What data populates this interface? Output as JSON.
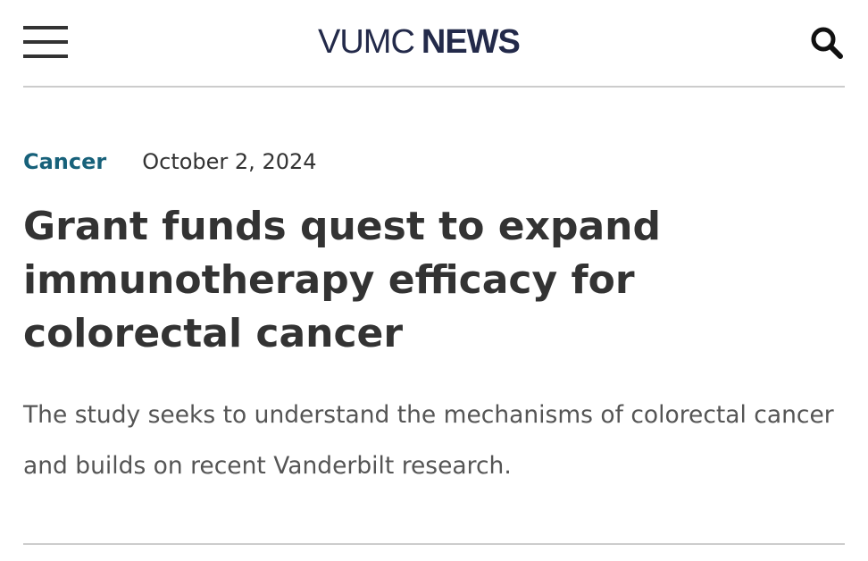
{
  "header": {
    "menu_icon": "hamburger-menu-icon",
    "logo": {
      "part1": "VUMC",
      "part2": "NEWS"
    },
    "search_icon": "search-icon"
  },
  "article": {
    "category": "Cancer",
    "date": "October 2, 2024",
    "headline": "Grant funds quest to expand immunotherapy efficacy for colorectal cancer",
    "summary": "The study seeks to understand the mechanisms of colorectal cancer and builds on recent Vanderbilt research."
  },
  "colors": {
    "logo": "#232a4a",
    "category": "#17617a",
    "headline": "#333333",
    "summary": "#555555",
    "divider": "#cccccc"
  }
}
